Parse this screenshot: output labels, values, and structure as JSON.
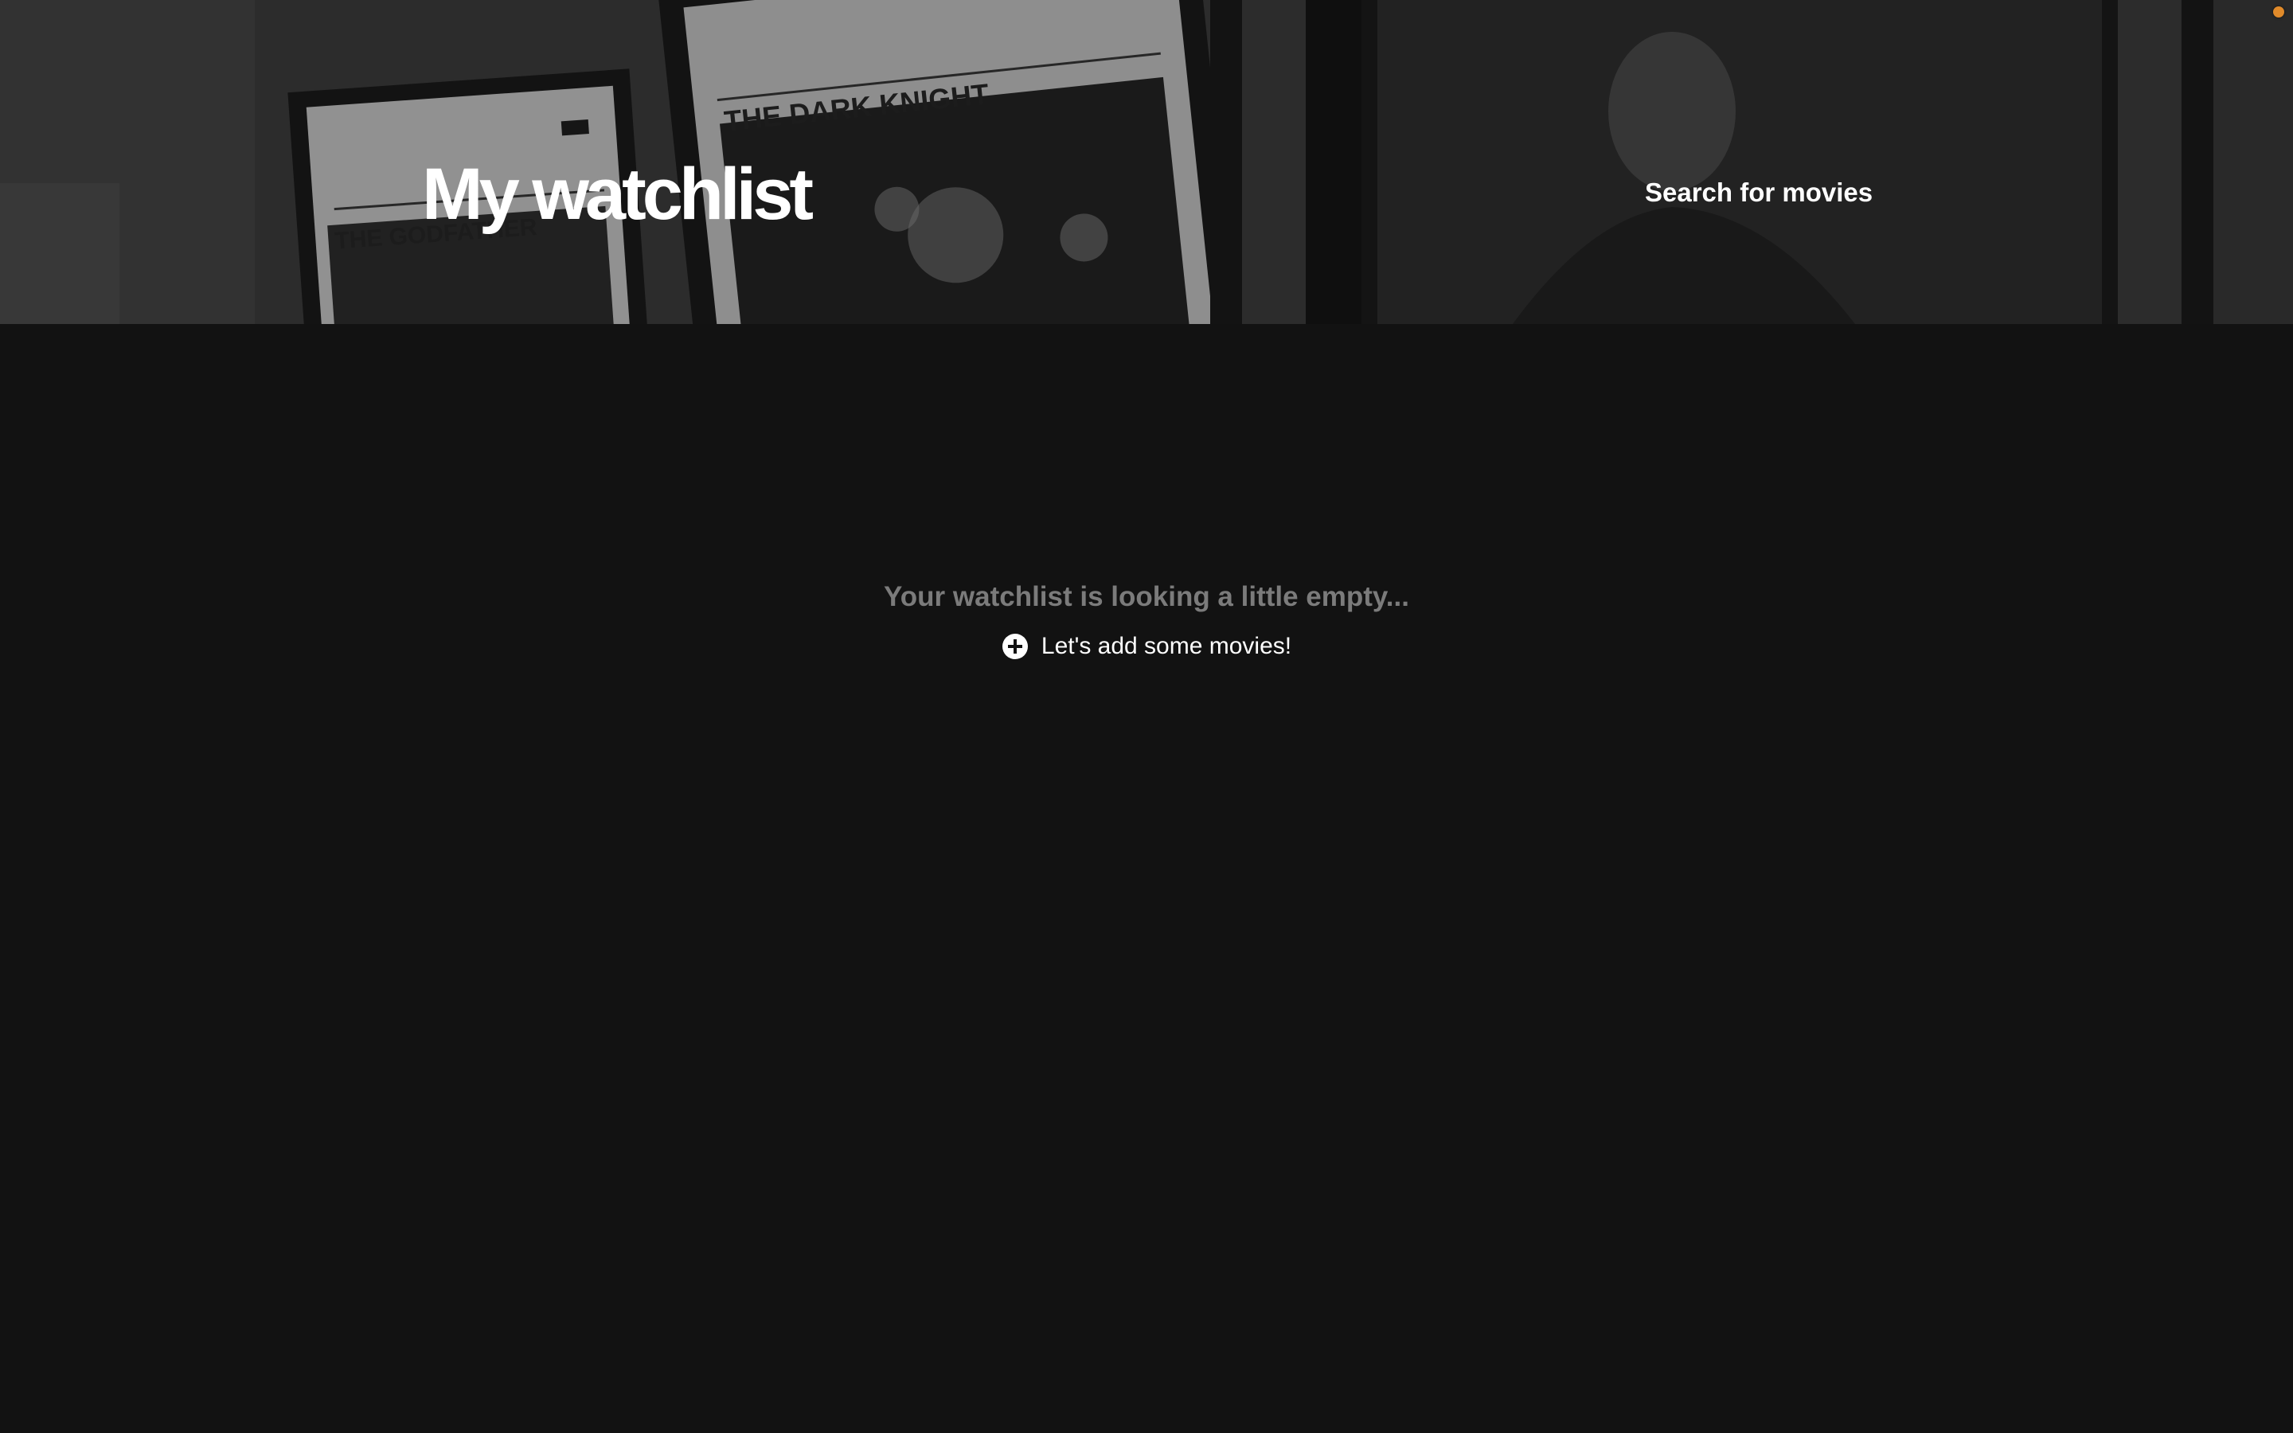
{
  "header": {
    "title": "My watchlist",
    "search_link_label": "Search for movies",
    "poster_captions": [
      "THE GODFATHER",
      "THE DARK KNIGHT"
    ]
  },
  "empty_state": {
    "message": "Your watchlist is looking a little empty...",
    "add_link_label": "Let's add some movies!",
    "add_icon": "plus-circle-icon"
  },
  "colors": {
    "background": "#121212",
    "title_text": "#ffffff",
    "muted_text": "#7b7b7b",
    "status_dot": "#e08a2a"
  }
}
